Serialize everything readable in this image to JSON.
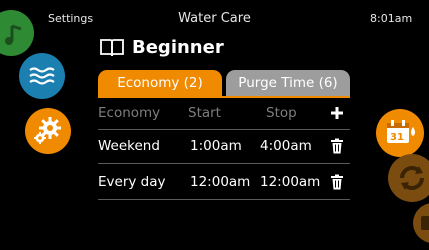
{
  "status": {
    "left_label": "Settings",
    "title": "Water Care",
    "time": "8:01am"
  },
  "page": {
    "title": "Beginner",
    "icon": "book-icon"
  },
  "tabs": [
    {
      "label": "Economy (2)",
      "active": true
    },
    {
      "label": "Purge Time (6)",
      "active": false
    }
  ],
  "table": {
    "headers": [
      "Economy",
      "Start",
      "Stop"
    ],
    "add_icon": "plus-icon",
    "rows": [
      {
        "name": "Weekend",
        "start": "1:00am",
        "stop": "4:00am",
        "action_icon": "trash-icon"
      },
      {
        "name": "Every day",
        "start": "12:00am",
        "stop": "12:00am",
        "action_icon": "trash-icon"
      }
    ]
  },
  "nav": {
    "left": [
      "green-nav-icon",
      "water-icon",
      "gear-icon"
    ],
    "right": [
      "calendar-icon",
      "refresh-icon",
      "more-icon"
    ]
  },
  "colors": {
    "accent": "#f08a00",
    "tab_inactive": "#9d9d9d",
    "header_text": "#7d7d7d",
    "background": "#000000",
    "water": "#1b7fb0",
    "green": "#2f8b33"
  }
}
